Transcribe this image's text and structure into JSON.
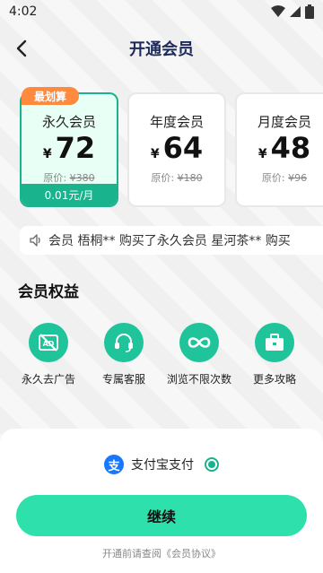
{
  "status_bar": {
    "time": "4:02"
  },
  "header": {
    "title": "开通会员"
  },
  "plans": [
    {
      "badge": "最划算",
      "name": "永久会员",
      "currency": "¥",
      "price": "72",
      "orig_label": "原价:",
      "orig_price": "¥380",
      "footer": "0.01元/月",
      "selected": true
    },
    {
      "name": "年度会员",
      "currency": "¥",
      "price": "64",
      "orig_label": "原价:",
      "orig_price": "¥180",
      "selected": false
    },
    {
      "name": "月度会员",
      "currency": "¥",
      "price": "48",
      "orig_label": "原价:",
      "orig_price": "¥96",
      "selected": false
    }
  ],
  "ticker": {
    "text": "会员  梧桐** 购买了永久会员  星河茶** 购买"
  },
  "benefits_section": {
    "title": "会员权益",
    "items": [
      {
        "label": "永久去广告",
        "icon": "no-ads-icon"
      },
      {
        "label": "专属客服",
        "icon": "headset-icon"
      },
      {
        "label": "浏览不限次数",
        "icon": "infinity-icon"
      },
      {
        "label": "更多攻略",
        "icon": "briefcase-icon"
      }
    ]
  },
  "payment": {
    "method": "支付宝支付",
    "icon_text": "支"
  },
  "continue_label": "继续",
  "agreement": "开通前请查阅《会员协议》",
  "colors": {
    "accent": "#19b38d",
    "button": "#2ee0ac",
    "badge": "#ff8a3d",
    "title": "#1d2a5a"
  }
}
